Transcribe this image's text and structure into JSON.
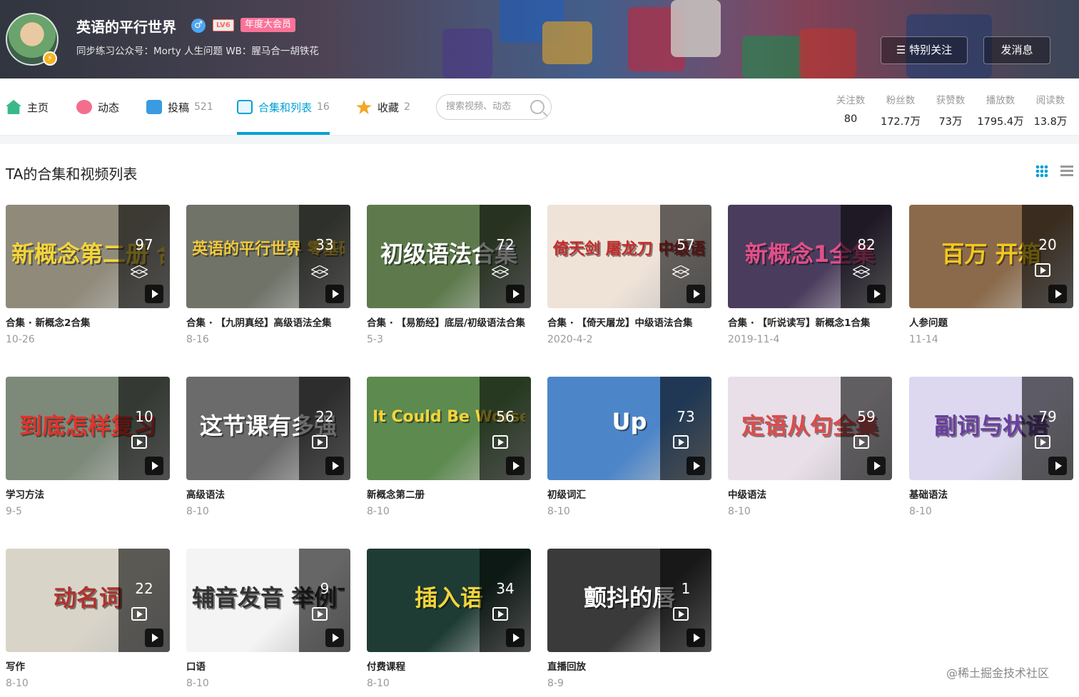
{
  "profile": {
    "name": "英语的平行世界",
    "gender_glyph": "♂",
    "level": "LV6",
    "vip": "年度大会员",
    "sign": "同步练习公众号：Morty 人生问题 WB：腥马合一胡铁花",
    "follow_btn": "☰ 特别关注",
    "msg_btn": "发消息"
  },
  "nav": {
    "home": "主页",
    "dynamic": "动态",
    "videos": "投稿",
    "videos_count": "521",
    "collections": "合集和列表",
    "collections_count": "16",
    "favorites": "收藏",
    "favorites_count": "2",
    "search_placeholder": "搜索视频、动态"
  },
  "stats": [
    {
      "label": "关注数",
      "value": "80"
    },
    {
      "label": "粉丝数",
      "value": "172.7万"
    },
    {
      "label": "获赞数",
      "value": "73万"
    },
    {
      "label": "播放数",
      "value": "1795.4万"
    },
    {
      "label": "阅读数",
      "value": "13.8万"
    }
  ],
  "section_title": "TA的合集和视频列表",
  "cards": [
    {
      "count": "97",
      "kind": "collection",
      "title": "合集 · 新概念2合集",
      "date": "10-26",
      "art": "新概念第二册 合集",
      "art_color": "#f4d43c",
      "bg": "#8f8a7a"
    },
    {
      "count": "33",
      "kind": "collection",
      "title": "合集 · 【九阴真经】高级语法全集",
      "date": "8-16",
      "art": "英语的平行世界 零基础语法合集",
      "art_color": "#f2c93a",
      "bg": "#6f7368"
    },
    {
      "count": "72",
      "kind": "collection",
      "title": "合集 · 【易筋经】底层/初级语法合集",
      "date": "5-3",
      "art": "初级语法合集",
      "art_color": "#ffffff",
      "bg": "#5e7a4c"
    },
    {
      "count": "57",
      "kind": "collection",
      "title": "合集 · 【倚天屠龙】中级语法合集",
      "date": "2020-4-2",
      "art": "倚天剑 屠龙刀 中级语法合集",
      "art_color": "#c82a2a",
      "bg": "#efe3d8"
    },
    {
      "count": "82",
      "kind": "collection",
      "title": "合集 · 【听说读写】新概念1合集",
      "date": "2019-11-4",
      "art": "新概念1全集",
      "art_color": "#e1508a",
      "bg": "#4a3c5c"
    },
    {
      "count": "20",
      "kind": "list",
      "title": "人参问题",
      "date": "11-14",
      "art": "百万 开箱",
      "art_color": "#f4c81c",
      "bg": "#8a6a4a"
    },
    {
      "count": "10",
      "kind": "list",
      "title": "学习方法",
      "date": "9-5",
      "art": "到底怎样复习",
      "art_color": "#e1342c",
      "bg": "#7d8a7a"
    },
    {
      "count": "22",
      "kind": "list",
      "title": "高级语法",
      "date": "8-10",
      "art": "这节课有多强",
      "art_color": "#ffffff",
      "bg": "#6b6b6b"
    },
    {
      "count": "56",
      "kind": "list",
      "title": "新概念第二册",
      "date": "8-10",
      "art": "It Could Be Worse",
      "art_color": "#f4d43c",
      "bg": "#5d8a4f"
    },
    {
      "count": "73",
      "kind": "list",
      "title": "初级词汇",
      "date": "8-10",
      "art": "Up",
      "art_color": "#ffffff",
      "bg": "#4d86c8"
    },
    {
      "count": "59",
      "kind": "list",
      "title": "中级语法",
      "date": "8-10",
      "art": "定语从句全集",
      "art_color": "#e04a4a",
      "bg": "#e8dfe8"
    },
    {
      "count": "79",
      "kind": "list",
      "title": "基础语法",
      "date": "8-10",
      "art": "副词与状语",
      "art_color": "#6a3ea1",
      "bg": "#ddd8f0"
    },
    {
      "count": "22",
      "kind": "list",
      "title": "写作",
      "date": "8-10",
      "art": "动名词",
      "art_color": "#b0322c",
      "bg": "#d9d4c8"
    },
    {
      "count": "9",
      "kind": "list",
      "title": "口语",
      "date": "8-10",
      "art": "辅音发音 举例下",
      "art_color": "#333333",
      "bg": "#f4f4f4"
    },
    {
      "count": "34",
      "kind": "list",
      "title": "付费课程",
      "date": "8-10",
      "art": "插入语",
      "art_color": "#f4d43c",
      "bg": "#1f3c34"
    },
    {
      "count": "1",
      "kind": "list",
      "title": "直播回放",
      "date": "8-9",
      "art": "颤抖的唇",
      "art_color": "#ffffff",
      "bg": "#3a3a3a"
    }
  ],
  "watermark": "@稀土掘金技术社区",
  "colors": {
    "accent": "#00a1d6",
    "vip_pink": "#fb7299",
    "level_red": "#ff6a57"
  }
}
